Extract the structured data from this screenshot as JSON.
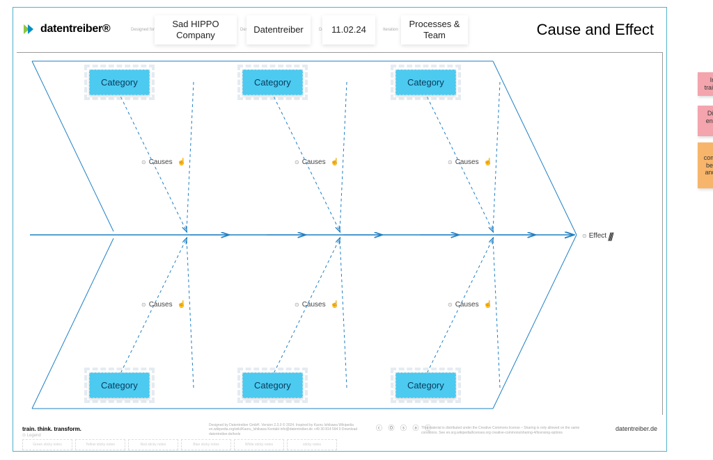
{
  "logo_text": "datentreiber®",
  "header_fields": {
    "designed_for_label": "Designed for",
    "designed_for": "Sad HIPPO Company",
    "designed_by_label": "Designed by",
    "designed_by": "Datentreiber",
    "date_label": "Date",
    "date": "11.02.24",
    "iteration_label": "Iteration",
    "iteration": "Processes & Team"
  },
  "title": "Cause and Effect",
  "categories_top": [
    "Category",
    "Category",
    "Category"
  ],
  "categories_bottom": [
    "Category",
    "Category",
    "Category"
  ],
  "causes_label": "Causes",
  "effect_label": "Effect",
  "sticky_notes": [
    {
      "text": "Insufficient training of staff",
      "color": "pink"
    },
    {
      "text": "Difficulties in ensuring data quality",
      "color": "pink"
    },
    {
      "text": "Lack of communication between data and marketing team",
      "color": "orange"
    }
  ],
  "footer": {
    "left": "train. think. transform.",
    "mid": "Designed by Datentreiber GmbH. Version 2.3.0 © 2024.\nInspired by Kaoru Ishikawa Wikipedia en.wikipedia.org/wiki/Kaoru_Ishikawa\nKontakt info@datentreiber.de +49 30 814 594 0\nDownload datentreiber.de/tools",
    "smalltext": "This material is distributed under the Creative Commons license – Sharing is only allowed on the same conditions.\nSee en.org.wikipedia/licenses.org creative-commons/sharing-4/licensing-options",
    "right": "datentreiber.de"
  },
  "legend": [
    "Green sticky notes",
    "Yellow sticky notes",
    "Red sticky notes",
    "Blue sticky notes",
    "White sticky notes",
    "sticky notes"
  ]
}
